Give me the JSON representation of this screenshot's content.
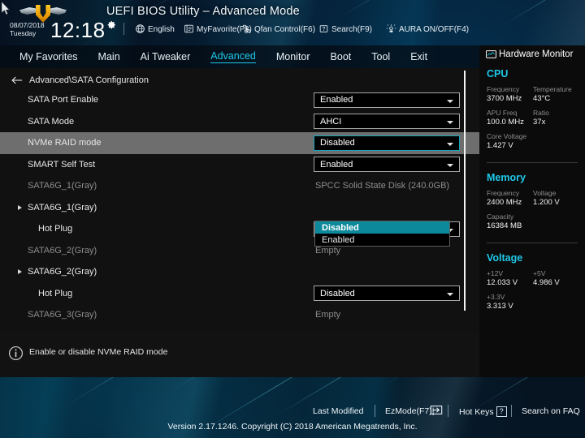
{
  "header": {
    "title": "UEFI BIOS Utility – Advanced Mode",
    "logo_name": "tuf-logo",
    "date": "08/07/2018",
    "day": "Tuesday",
    "time": "12:18",
    "items": [
      {
        "label": "English",
        "icon": "globe-icon"
      },
      {
        "label": "MyFavorite(F3)",
        "icon": "favorite-icon"
      },
      {
        "label": "Qfan Control(F6)",
        "icon": "fan-icon"
      },
      {
        "label": "Search(F9)",
        "icon": "search-icon"
      },
      {
        "label": "AURA ON/OFF(F4)",
        "icon": "aura-icon"
      }
    ]
  },
  "nav": {
    "tabs": [
      {
        "label": "My Favorites",
        "active": false
      },
      {
        "label": "Main",
        "active": false
      },
      {
        "label": "Ai Tweaker",
        "active": false
      },
      {
        "label": "Advanced",
        "active": true
      },
      {
        "label": "Monitor",
        "active": false
      },
      {
        "label": "Boot",
        "active": false
      },
      {
        "label": "Tool",
        "active": false
      },
      {
        "label": "Exit",
        "active": false
      }
    ]
  },
  "breadcrumb": {
    "text": "Advanced\\SATA Configuration",
    "back_icon": "back-arrow-icon"
  },
  "settings": [
    {
      "label": "SATA Port Enable",
      "type": "dropdown",
      "value": "Enabled",
      "indent": "lv0",
      "dim": false
    },
    {
      "label": "SATA Mode",
      "type": "dropdown",
      "value": "AHCI",
      "indent": "lv0",
      "dim": false
    },
    {
      "label": "NVMe RAID mode",
      "type": "dropdown",
      "value": "Disabled",
      "indent": "lv0",
      "dim": false,
      "selected": true,
      "open": true
    },
    {
      "label": "SMART Self Test",
      "type": "dropdown",
      "value": "Enabled",
      "indent": "lv0",
      "dim": false
    },
    {
      "label": "SATA6G_1(Gray)",
      "type": "text",
      "value": "SPCC Solid State Disk (240.0GB)",
      "indent": "lv0",
      "dim": true
    },
    {
      "label": "SATA6G_1(Gray)",
      "type": "submenu",
      "value": "",
      "indent": "lv2",
      "dim": false
    },
    {
      "label": "Hot Plug",
      "type": "dropdown",
      "value": "Disabled",
      "indent": "lv1",
      "dim": false
    },
    {
      "label": "SATA6G_2(Gray)",
      "type": "text",
      "value": "Empty",
      "indent": "lv0",
      "dim": true
    },
    {
      "label": "SATA6G_2(Gray)",
      "type": "submenu",
      "value": "",
      "indent": "lv2",
      "dim": false
    },
    {
      "label": "Hot Plug",
      "type": "dropdown",
      "value": "Disabled",
      "indent": "lv1",
      "dim": false
    },
    {
      "label": "SATA6G_3(Gray)",
      "type": "text",
      "value": "Empty",
      "indent": "lv0",
      "dim": true
    },
    {
      "label": "SATA6G_3(Gray)",
      "type": "submenu",
      "value": "",
      "indent": "lv2",
      "dim": false
    }
  ],
  "dropdown_menu": {
    "options": [
      {
        "label": "Disabled",
        "highlighted": true
      },
      {
        "label": "Enabled",
        "highlighted": false
      }
    ]
  },
  "help": {
    "icon": "info-icon",
    "text": "Enable or disable NVMe RAID mode"
  },
  "hardware_monitor": {
    "title": "Hardware Monitor",
    "icon": "monitor-icon",
    "sections": [
      {
        "name": "CPU",
        "pairs": [
          {
            "key": "Frequency",
            "value": "3700 MHz"
          },
          {
            "key": "Temperature",
            "value": "43°C"
          },
          {
            "key": "APU Freq",
            "value": "100.0 MHz"
          },
          {
            "key": "Ratio",
            "value": "37x"
          },
          {
            "key": "Core Voltage",
            "value": "1.427 V"
          }
        ]
      },
      {
        "name": "Memory",
        "pairs": [
          {
            "key": "Frequency",
            "value": "2400 MHz"
          },
          {
            "key": "Voltage",
            "value": "1.200 V"
          },
          {
            "key": "Capacity",
            "value": "16384 MB"
          }
        ]
      },
      {
        "name": "Voltage",
        "pairs": [
          {
            "key": "+12V",
            "value": "12.033 V"
          },
          {
            "key": "+5V",
            "value": "4.986 V"
          },
          {
            "key": "+3.3V",
            "value": "3.313 V"
          }
        ]
      }
    ]
  },
  "bottom_bar": {
    "last_modified": "Last Modified",
    "ez_mode": "EzMode(F7)|",
    "hot_keys": "Hot Keys",
    "hot_keys_badge": "?",
    "search_faq": "Search on FAQ"
  },
  "footer": {
    "version": "Version 2.17.1246. Copyright (C) 2018 American Megatrends, Inc."
  },
  "colors": {
    "accent": "#1ec8e8",
    "highlight": "#0c8a9b",
    "selected_row": "#6e6e6e",
    "panel": "#111111"
  }
}
